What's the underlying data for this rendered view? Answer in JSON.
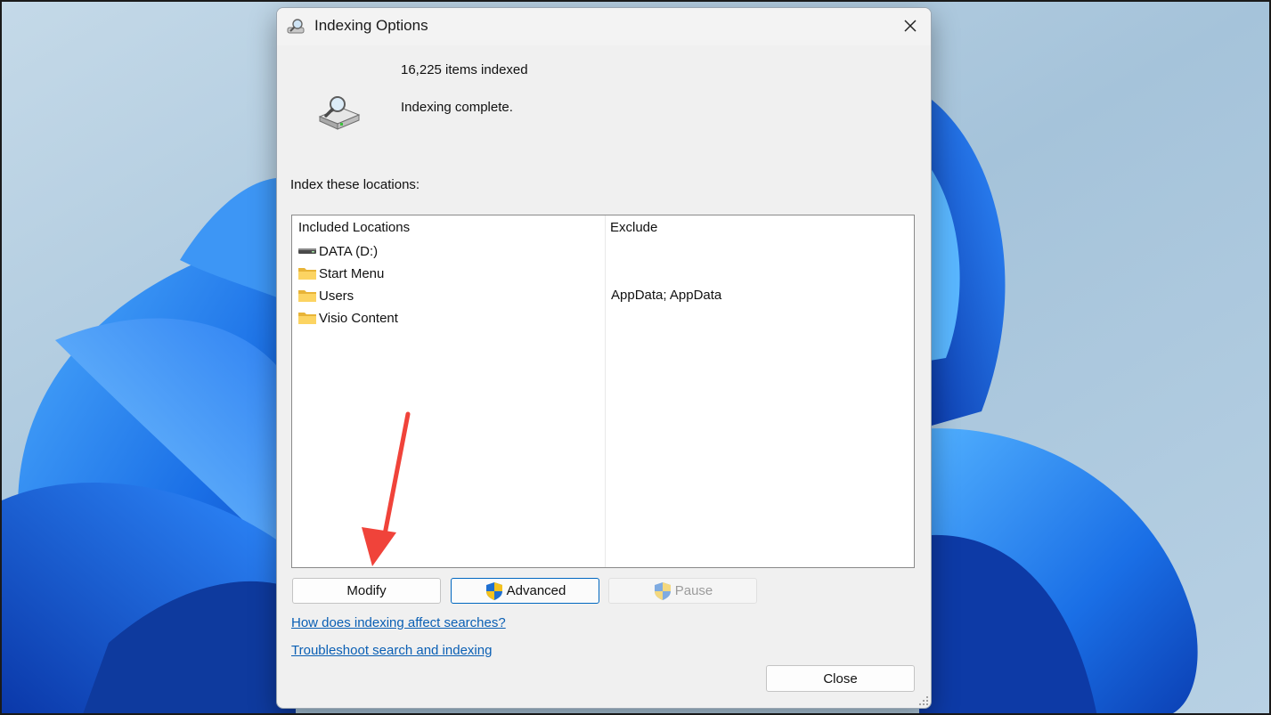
{
  "window": {
    "title": "Indexing Options"
  },
  "status": {
    "items_indexed": "16,225 items indexed",
    "state": "Indexing complete."
  },
  "locations": {
    "label": "Index these locations:",
    "headers": {
      "included": "Included Locations",
      "exclude": "Exclude"
    },
    "rows": [
      {
        "name": "DATA (D:)",
        "icon": "drive-icon",
        "exclude": ""
      },
      {
        "name": "Start Menu",
        "icon": "folder-icon",
        "exclude": ""
      },
      {
        "name": "Users",
        "icon": "folder-icon",
        "exclude": "AppData; AppData"
      },
      {
        "name": "Visio Content",
        "icon": "folder-icon",
        "exclude": ""
      }
    ]
  },
  "buttons": {
    "modify": "Modify",
    "advanced": "Advanced",
    "pause": "Pause",
    "close": "Close"
  },
  "links": {
    "help": "How does indexing affect searches?",
    "troubleshoot": "Troubleshoot search and indexing"
  },
  "colors": {
    "accent": "#0067c0",
    "link": "#0a5fb4",
    "annotation_arrow": "#f0433a"
  }
}
